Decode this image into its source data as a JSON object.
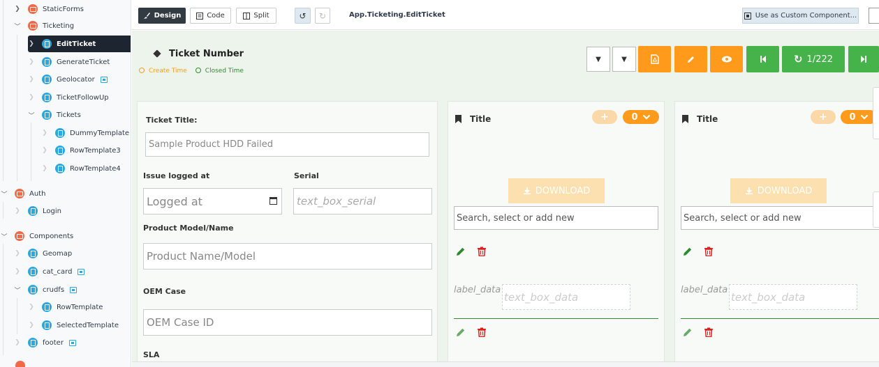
{
  "sidebar": {
    "items": [
      {
        "label": "StaticForms",
        "kind": "folder",
        "expanded": false
      },
      {
        "label": "Ticketing",
        "kind": "folder",
        "expanded": true
      },
      {
        "label": "EditTicket",
        "kind": "file",
        "active": true
      },
      {
        "label": "GenerateTicket",
        "kind": "file"
      },
      {
        "label": "Geolocator",
        "kind": "file",
        "badge": true
      },
      {
        "label": "TicketFollowUp",
        "kind": "file"
      },
      {
        "label": "Tickets",
        "kind": "file",
        "expanded": true
      },
      {
        "label": "DummyTemplate",
        "kind": "file"
      },
      {
        "label": "RowTemplate3",
        "kind": "file"
      },
      {
        "label": "RowTemplate4",
        "kind": "file"
      },
      {
        "label": "Auth",
        "kind": "folder",
        "expanded": true
      },
      {
        "label": "Login",
        "kind": "file"
      },
      {
        "label": "Components",
        "kind": "folder",
        "expanded": true
      },
      {
        "label": "Geomap",
        "kind": "file"
      },
      {
        "label": "cat_card",
        "kind": "file",
        "badge": true
      },
      {
        "label": "crudfs",
        "kind": "file",
        "badge": true,
        "expanded": true
      },
      {
        "label": "RowTemplate",
        "kind": "file"
      },
      {
        "label": "SelectedTemplate",
        "kind": "file"
      },
      {
        "label": "footer",
        "kind": "file",
        "badge": true
      }
    ]
  },
  "toolbar": {
    "design_label": "Design",
    "code_label": "Code",
    "split_label": "Split",
    "doc_path": "App.Ticketing.EditTicket",
    "custom_component_label": "Use as Custom Component..."
  },
  "header": {
    "title": "Ticket Number",
    "create_time_label": "Create Time",
    "closed_time_label": "Closed Time",
    "record_counter": "1/222"
  },
  "form": {
    "ticket_title_label": "Ticket Title:",
    "ticket_title_value": "Sample Product HDD Failed",
    "issue_logged_label": "Issue logged at",
    "logged_at_placeholder": "Logged at",
    "serial_label": "Serial",
    "serial_placeholder": "text_box_serial",
    "product_model_label": "Product Model/Name",
    "product_model_placeholder": "Product Name/Model",
    "oem_case_label": "OEM Case",
    "oem_case_placeholder": "OEM Case ID",
    "sla_label": "SLA"
  },
  "cards": [
    {
      "title": "Title",
      "count": "0",
      "download_label": "DOWNLOAD",
      "search_placeholder": "Search, select or add new",
      "label_data": "label_data",
      "text_box_data": "text_box_data"
    },
    {
      "title": "Title",
      "count": "0",
      "download_label": "DOWNLOAD",
      "search_placeholder": "Search, select or add new",
      "label_data": "label_data",
      "text_box_data": "text_box_data"
    }
  ],
  "colors": {
    "accent_orange": "#ff9a1a",
    "accent_green": "#46b24a",
    "danger_red": "#e02020",
    "canvas_bg": "#edf4ec"
  }
}
